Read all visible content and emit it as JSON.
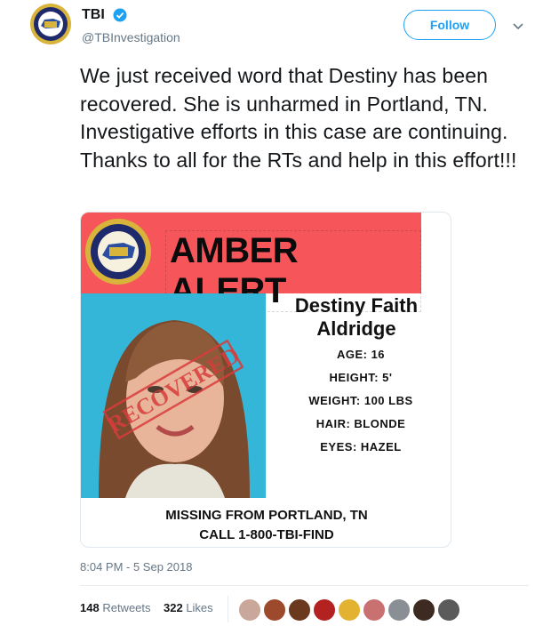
{
  "account": {
    "display_name": "TBI",
    "handle": "@TBInvestigation",
    "avatar_icon": "tbi-seal-icon",
    "verified_icon": "verified-badge-icon"
  },
  "actions": {
    "follow_label": "Follow",
    "more_icon": "chevron-down-icon"
  },
  "tweet": {
    "text": "We just received word that Destiny has been recovered. She is unharmed in Portland, TN. Investigative efforts in this case are continuing. Thanks to all for the RTs and help in this effort!!!"
  },
  "alert_card": {
    "title": "AMBER ALERT",
    "name_line1": "Destiny Faith",
    "name_line2": "Aldridge",
    "stamp": "RECOVERED",
    "age": "AGE: 16",
    "height": "HEIGHT: 5'",
    "weight": "WEIGHT: 100 LBS",
    "hair": "HAIR: BLONDE",
    "eyes": "EYES: HAZEL",
    "missing_from": "MISSING FROM PORTLAND, TN",
    "call": "CALL 1-800-TBI-FIND",
    "banner_color": "#f6555a"
  },
  "meta": {
    "timestamp": "8:04 PM - 5 Sep 2018",
    "retweets_count": "148",
    "retweets_label": "Retweets",
    "likes_count": "322",
    "likes_label": "Likes"
  },
  "colors": {
    "accent": "#1da1f2",
    "muted": "#657786"
  }
}
